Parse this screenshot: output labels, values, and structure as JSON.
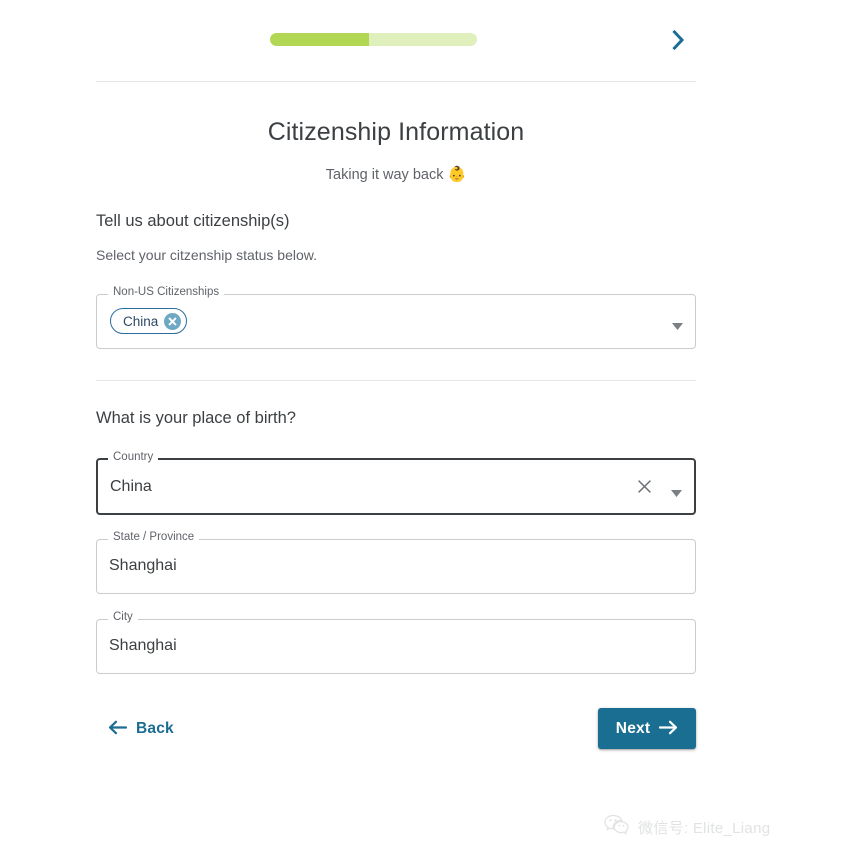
{
  "progress": {
    "percent": 48,
    "track_color": "#dff0bd",
    "fill_color": "#b2d755"
  },
  "header": {
    "forward_chevron_icon": "chevron-right-icon",
    "title": "Citizenship Information",
    "subtitle_text": "Taking it way back",
    "subtitle_emoji": "👶"
  },
  "citizenship_section": {
    "question": "Tell us about citizenship(s)",
    "helper": "Select your citzenship status below.",
    "field": {
      "label": "Non-US Citizenships",
      "chips": [
        {
          "label": "China",
          "delete_icon": "close-circle-icon"
        }
      ],
      "dropdown_icon": "triangle-down-icon"
    }
  },
  "birth_section": {
    "question": "What is your place of birth?",
    "country": {
      "label": "Country",
      "value": "China",
      "clear_icon": "clear-x-icon",
      "dropdown_icon": "triangle-down-icon",
      "focused": true
    },
    "state": {
      "label": "State / Province",
      "value": "Shanghai",
      "placeholder": ""
    },
    "city": {
      "label": "City",
      "value": "Shanghai",
      "placeholder": ""
    }
  },
  "footer": {
    "back_label": "Back",
    "back_icon": "arrow-left-icon",
    "next_label": "Next",
    "next_icon": "arrow-right-icon",
    "next_button_color": "#1a6e91",
    "link_color": "#1b6d93"
  },
  "watermark": {
    "icon": "wechat-icon",
    "text": "微信号: Elite_Liang"
  }
}
